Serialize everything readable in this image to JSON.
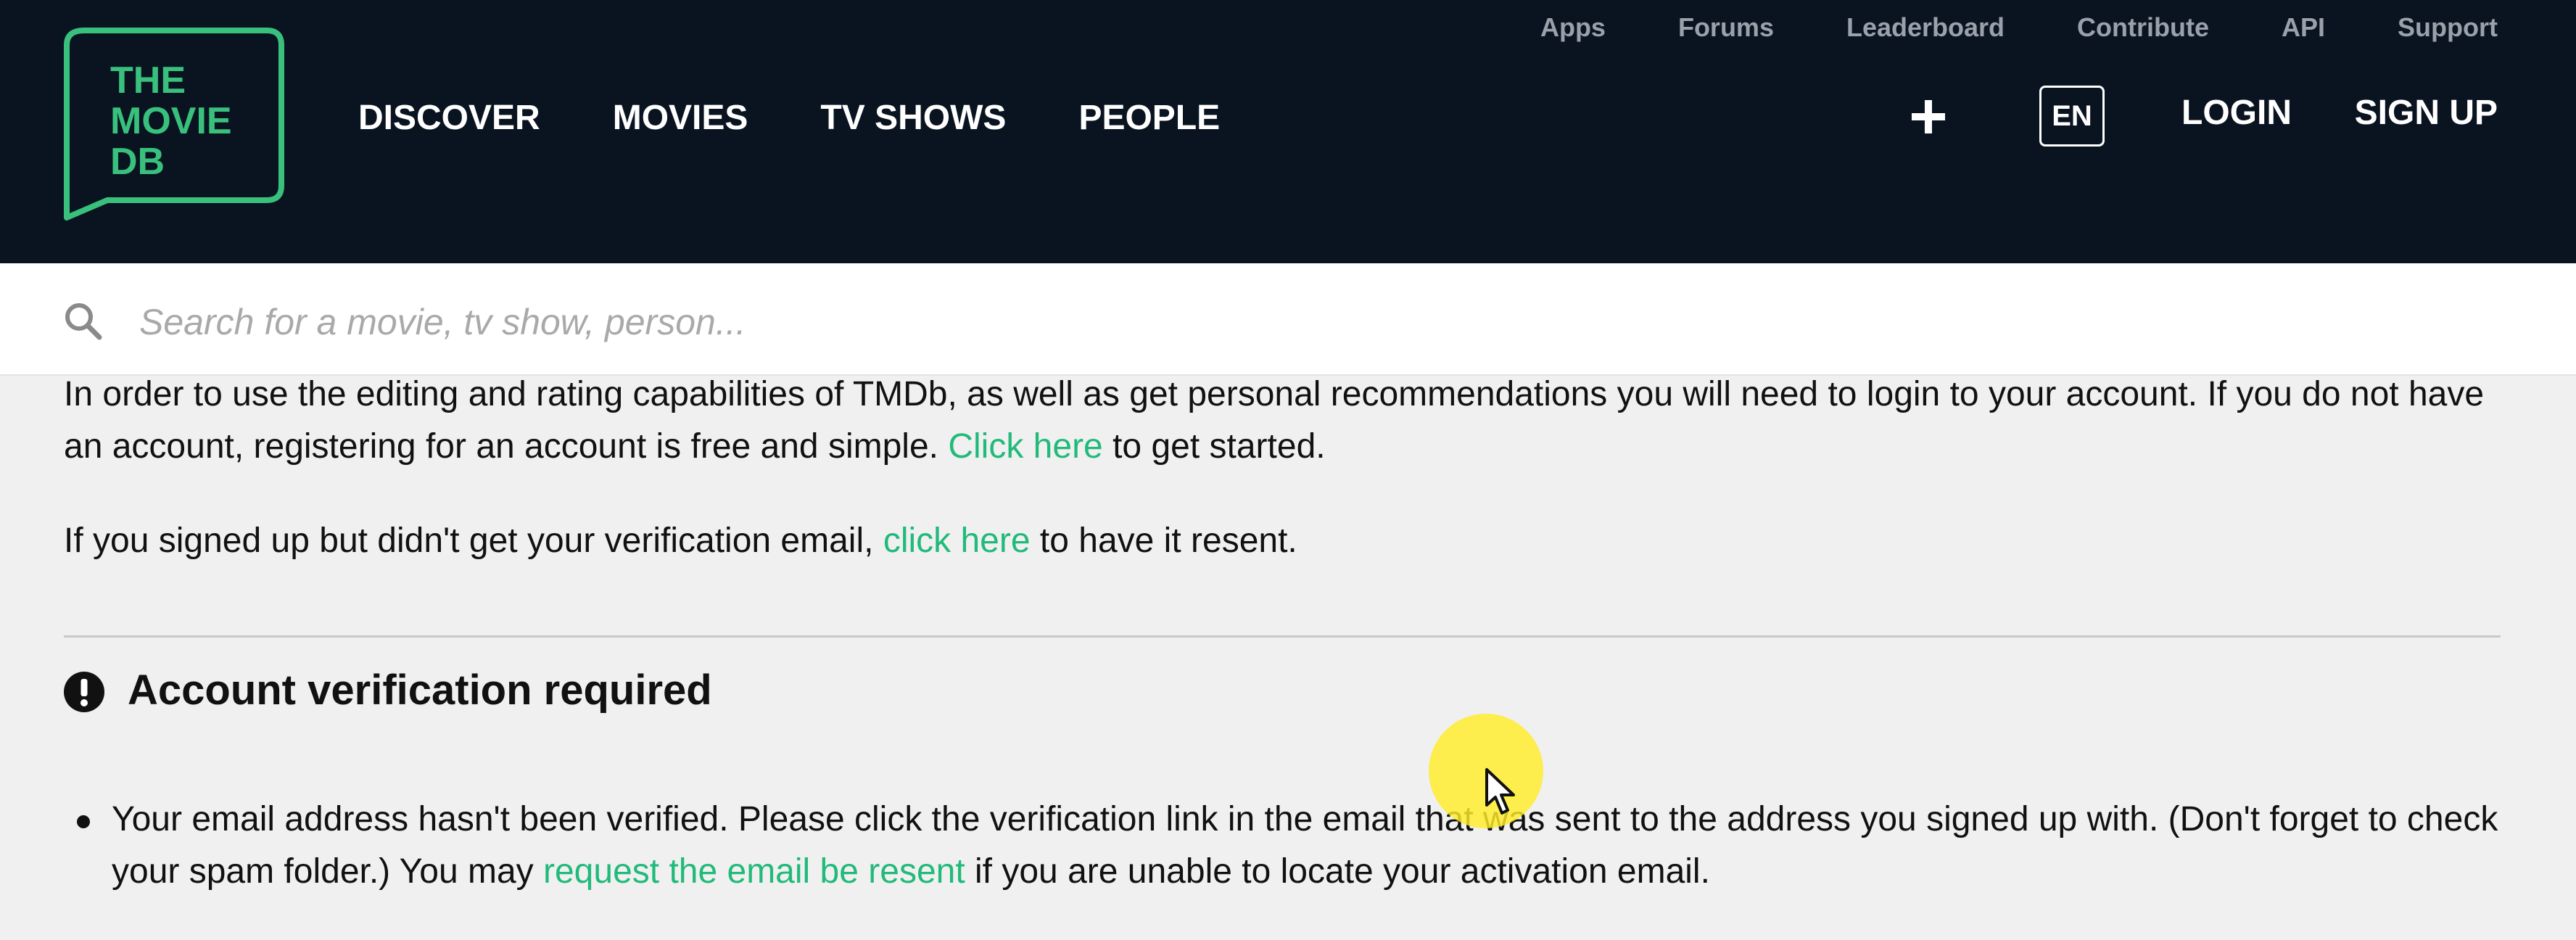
{
  "logo": {
    "lines": [
      "THE",
      "MOVIE",
      "DB"
    ],
    "accent": "#39c07d"
  },
  "top_links": [
    "Apps",
    "Forums",
    "Leaderboard",
    "Contribute",
    "API",
    "Support"
  ],
  "nav": [
    "DISCOVER",
    "MOVIES",
    "TV SHOWS",
    "PEOPLE"
  ],
  "header_right": {
    "add_icon": "plus-icon",
    "language": "EN",
    "login": "LOGIN",
    "signup": "SIGN UP"
  },
  "search": {
    "icon": "search-icon",
    "placeholder": "Search for a movie, tv show, person..."
  },
  "intro": {
    "text_before": "In order to use the editing and rating capabilities of TMDb, as well as get personal recommendations you will need to login to your account. If you do not have an account, registering for an account is free and simple.",
    "link": "Click here",
    "text_after": "to get started."
  },
  "resend": {
    "text_before": "If you signed up but didn't get your verification email,",
    "link": "click here",
    "text_after": "to have it resent."
  },
  "verification": {
    "icon": "exclamation-circle-icon",
    "title": "Account verification required",
    "text_before": "Your email address hasn't been verified. Please click the verification link in the email that was sent to the address you signed up with. (Don't forget to check your spam folder.) You may",
    "link": "request the email be resent",
    "text_after": "if you are unable to locate your activation email."
  },
  "colors": {
    "header_bg": "#0a1421",
    "link": "#21ba7a",
    "page_bg": "#f0f0f0"
  }
}
